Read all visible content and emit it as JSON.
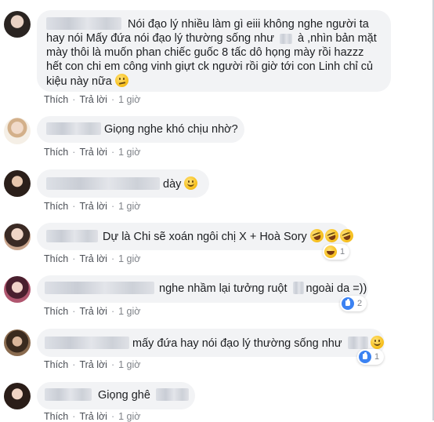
{
  "actions": {
    "like": "Thích",
    "reply": "Trả lời",
    "time": "1 giờ",
    "sep": "·"
  },
  "comments": [
    {
      "text": "Nói đạo lý nhiều làm gì eiii không nghe người ta hay nói Mấy đứa nói đạo lý thường sống như",
      "text2": "à ,nhìn bản mặt mày thôi là muốn phan chiếc guốc 8 tấc dô họng mày rồi hazzz hết con chi em công vinh giựt ck người rồi giờ tới con Linh chỉ củ kiệu này nữa",
      "emoji": "confused-face"
    },
    {
      "text": "Giọng nghe khó chịu nhờ?"
    },
    {
      "text": "dày",
      "emoji": "smiling-face"
    },
    {
      "text": "Dự là Chi sẽ xoán ngôi chị X + Hoà Sory",
      "emoji": "rofl-face",
      "reaction": {
        "type": "haha",
        "count": "1"
      }
    },
    {
      "text": "nghe nhầm lại tưởng ruột",
      "text2": "ngoài da =))",
      "reaction": {
        "type": "like",
        "count": "2"
      }
    },
    {
      "text": "mấy đứa hay nói đạo lý thường sống như",
      "emoji": "smiling-face",
      "reaction": {
        "type": "like",
        "count": "1"
      }
    },
    {
      "text": "Giọng ghê"
    }
  ]
}
